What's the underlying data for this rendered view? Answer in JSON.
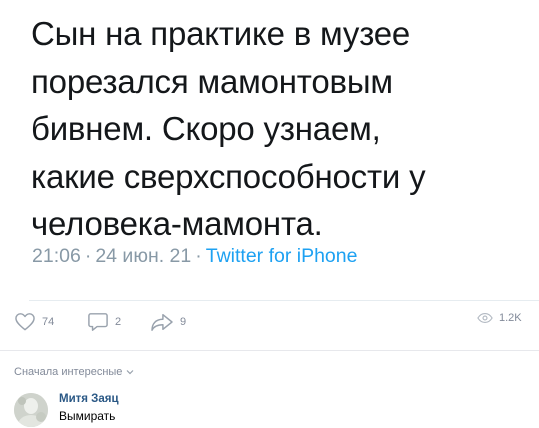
{
  "tweet": {
    "lines": [
      "Сын на практике в музее",
      "порезался мамонтовым",
      "бивнем. Скоро узнаем,",
      "какие сверхспособности у",
      "человека-мамонта."
    ],
    "time": "21:06",
    "date": "24 июн. 21",
    "separator": "·",
    "source": "Twitter for iPhone"
  },
  "actions": {
    "like_count": "74",
    "comment_count": "2",
    "share_count": "9",
    "views_count": "1.2K",
    "icons": [
      "heart-icon",
      "comment-icon",
      "share-icon",
      "eye-icon"
    ]
  },
  "comments": {
    "sort_label": "Сначала интересные",
    "items": [
      {
        "author": "Митя Заяц",
        "text": "Вымирать"
      }
    ]
  },
  "colors": {
    "text": "#14171a",
    "meta": "#8899a6",
    "link": "#1da1f2",
    "muted": "#828a99",
    "author": "#2a5885"
  }
}
